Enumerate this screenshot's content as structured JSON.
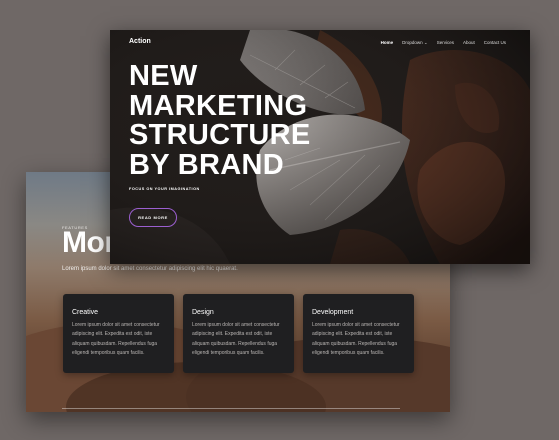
{
  "back_page": {
    "eyebrow": "FEATURES",
    "title": "Mor",
    "lead": "Lorem ipsum dolor sit amet consectetur adipiscing elit hic quaerat.",
    "features": [
      {
        "title": "Creative",
        "text": "Lorem ipsum dolor sit amet consectetur adipiscing elit. Expedita est odit, iste aliquam quibusdam. Repellendus fuga eligendi temporibus quam facilis."
      },
      {
        "title": "Design",
        "text": "Lorem ipsum dolor sit amet consectetur adipiscing elit. Expedita est odit, iste aliquam quibusdam. Repellendus fuga eligendi temporibus quam facilis."
      },
      {
        "title": "Development",
        "text": "Lorem ipsum dolor sit amet consectetur adipiscing elit. Expedita est odit, iste aliquam quibusdam. Repellendus fuga eligendi temporibus quam facilis."
      }
    ]
  },
  "front_page": {
    "brand": "Action",
    "nav": [
      {
        "label": "Home"
      },
      {
        "label": "Dropdown ⌄"
      },
      {
        "label": "Services"
      },
      {
        "label": "About"
      },
      {
        "label": "Contact Us"
      }
    ],
    "hero_lines": [
      "NEW",
      "MARKETING",
      "STRUCTURE",
      "BY BRAND"
    ],
    "tagline": "FOCUS ON YOUR IMAGINATION",
    "cta_label": "READ MORE"
  },
  "colors": {
    "background": "#6f6866",
    "card_dark": "#1f1f21",
    "cta_border": "#9b5fd0"
  }
}
